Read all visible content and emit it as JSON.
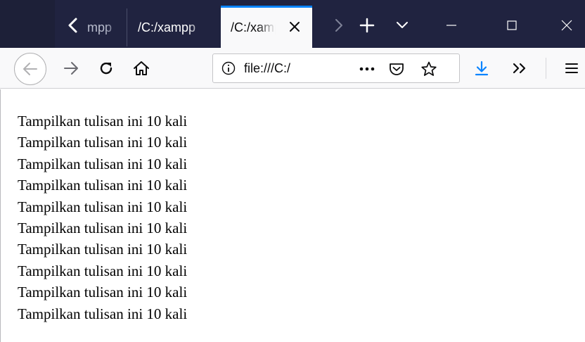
{
  "window": {
    "tabs": [
      {
        "title": "mpp",
        "state": "partial"
      },
      {
        "title": "/C:/xampp",
        "state": "background"
      },
      {
        "title": "/C:/xampp",
        "state": "active"
      }
    ],
    "controls": {
      "scroll_left_icon": "chevron-left-icon",
      "scroll_right_icon": "chevron-right-icon",
      "new_tab_icon": "plus-icon",
      "tab_list_icon": "chevron-down-icon",
      "minimize_icon": "minimize-icon",
      "maximize_icon": "maximize-icon",
      "close_icon": "close-icon"
    }
  },
  "toolbar": {
    "url": "file:///C:/",
    "icons": [
      "back-arrow-icon",
      "forward-arrow-icon",
      "reload-icon",
      "home-icon",
      "info-icon",
      "more-actions-icon",
      "pocket-icon",
      "bookmark-star-icon",
      "download-icon",
      "overflow-chevrons-icon",
      "hamburger-menu-icon"
    ]
  },
  "colors": {
    "tabstrip": "#202340",
    "active_tab": "#f9f9fa",
    "active_tab_accent": "#0a84ff",
    "download_icon": "#0a84ff",
    "page_background": "#ffffff"
  },
  "page": {
    "lines": [
      "Tampilkan tulisan ini 10 kali",
      "Tampilkan tulisan ini 10 kali",
      "Tampilkan tulisan ini 10 kali",
      "Tampilkan tulisan ini 10 kali",
      "Tampilkan tulisan ini 10 kali",
      "Tampilkan tulisan ini 10 kali",
      "Tampilkan tulisan ini 10 kali",
      "Tampilkan tulisan ini 10 kali",
      "Tampilkan tulisan ini 10 kali",
      "Tampilkan tulisan ini 10 kali"
    ]
  }
}
